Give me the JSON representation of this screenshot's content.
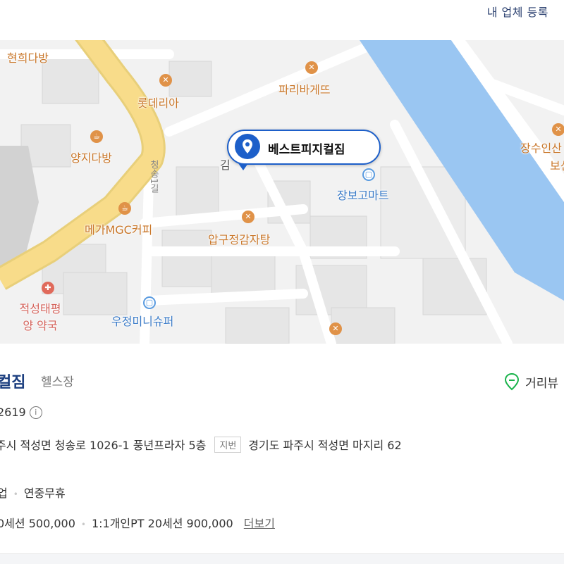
{
  "header": {
    "register_link": "내 업체 등록"
  },
  "map": {
    "selected_place": "베스트피지컬짐",
    "selected_place_partial": "김",
    "road_name": "청송1길",
    "pois": [
      {
        "label": "현희다방",
        "icon": "cafe-icon"
      },
      {
        "label": "롯데리아",
        "icon": "restaurant-icon"
      },
      {
        "label": "파리바게뜨",
        "icon": "restaurant-icon"
      },
      {
        "label": "양지다방",
        "icon": "cafe-icon"
      },
      {
        "label": "장보고마트",
        "icon": "mart-icon"
      },
      {
        "label": "메가MGC커피",
        "icon": "cafe-icon"
      },
      {
        "label": "압구정감자탕",
        "icon": "restaurant-icon"
      },
      {
        "label": "적성태평양 약국",
        "icon": "pharmacy-icon"
      },
      {
        "label": "우정미니슈퍼",
        "icon": "mart-icon"
      },
      {
        "label": "장수인산",
        "icon": "restaurant-icon"
      },
      {
        "label": "보신",
        "icon": "restaurant-icon"
      }
    ],
    "colors": {
      "river": "#9ac6f2",
      "main_road": "#f8dc8a",
      "pin": "#1d5fc9"
    }
  },
  "place": {
    "name": "컬짐",
    "category": "헬스장",
    "street_view_label": "거리뷰",
    "phone": "2619",
    "road_address": "주시 적성면 청송로 1026-1 풍년프라자 5층",
    "jibun_label": "지번",
    "jibun_address": "경기도 파주시 적성면 마지리 62",
    "hours_status": "업",
    "hours_note": "연중무휴",
    "price_item1": "0세션 500,000",
    "price_item2": "1:1개인PT 20세션 900,000",
    "more_link": "더보기"
  }
}
